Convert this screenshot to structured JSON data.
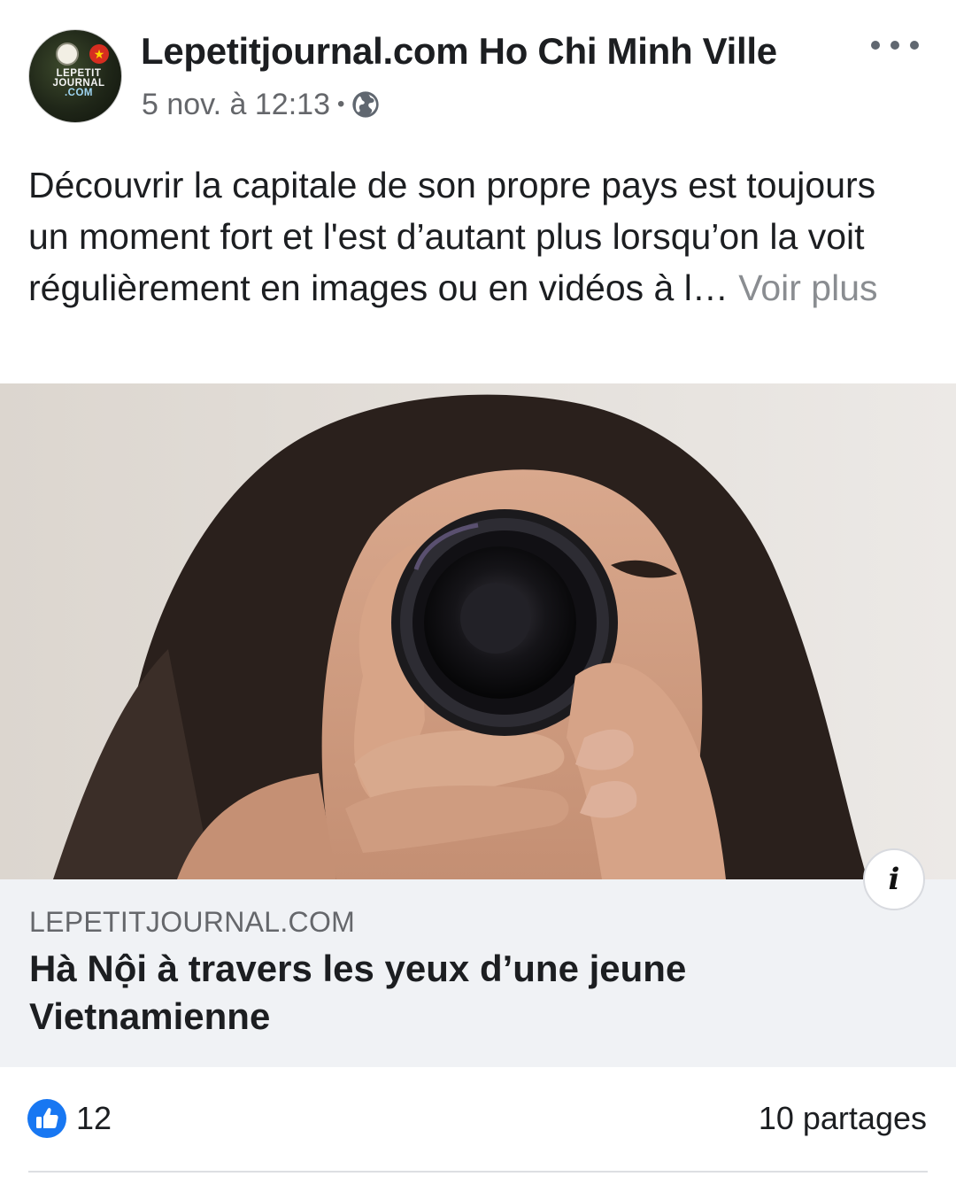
{
  "post": {
    "page_name": "Lepetitjournal.com Ho Chi Minh Ville",
    "timestamp": "5 nov. à 12:13",
    "separator": "•",
    "audience_icon": "globe-icon",
    "more_icon": "more-dots-icon",
    "avatar": {
      "logo_line1": "LEPETIT",
      "logo_line2": "JOURNAL",
      "logo_line3": ".COM"
    },
    "text": "Découvrir la capitale de son propre pays est toujours un moment fort et l'est d’autant plus lorsqu’on la voit régulièrement en images ou en vidéos à l…",
    "see_more_label": "Voir plus"
  },
  "link_preview": {
    "domain": "LEPETITJOURNAL.COM",
    "title": "Hà Nội à travers les yeux d’une jeune Vietnamienne",
    "info_label": "i"
  },
  "reactions": {
    "like_icon": "thumbs-up-icon",
    "like_count": "12",
    "shares": "10 partages"
  },
  "colors": {
    "like_blue": "#1877f2",
    "secondary_text": "#65676b",
    "preview_bg": "#f0f2f5"
  }
}
